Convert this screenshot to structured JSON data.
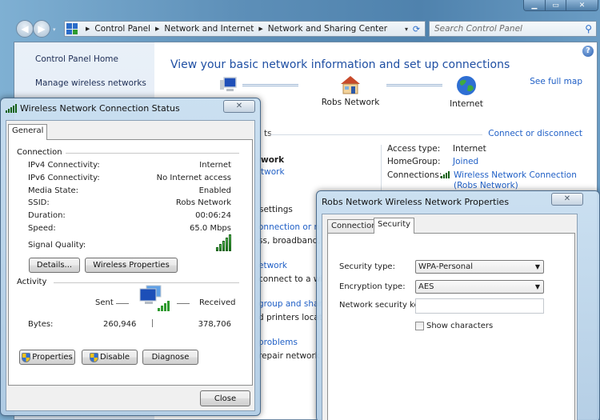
{
  "explorer": {
    "window_controls": {
      "minimize": "▁",
      "maximize": "▭",
      "close": "✕"
    },
    "nav": {
      "back_icon": "◀",
      "forward_icon": "▶",
      "dropdown_icon": "▾"
    },
    "breadcrumb": [
      "Control Panel",
      "Network and Internet",
      "Network and Sharing Center"
    ],
    "refresh_icon": "⟳",
    "search": {
      "placeholder": "Search Control Panel",
      "icon": "⚲"
    },
    "left_pane": {
      "items": [
        "Control Panel Home",
        "Manage wireless networks"
      ]
    },
    "help_icon": "?",
    "page_title": "View your basic network information and set up connections",
    "map": {
      "nodes": [
        "",
        "Robs Network",
        "Internet"
      ],
      "see_full_map": "See full map"
    },
    "connect_or_disconnect": "Connect or disconnect",
    "active_network_partial": {
      "section": "ts",
      "name": "work",
      "type": "twork"
    },
    "access": {
      "access_type_label": "Access type:",
      "access_type_value": "Internet",
      "homegroup_label": "HomeGroup:",
      "homegroup_value": "Joined",
      "connections_label": "Connections:",
      "connections_value_1": "Wireless Network Connection",
      "connections_value_2": "(Robs Network)"
    },
    "settings_partial": {
      "header": "settings",
      "items": [
        {
          "link": "onnection or n",
          "desc": "ss, broadband,"
        },
        {
          "link": "etwork",
          "desc": "connect to a wi"
        },
        {
          "link": "group and shar",
          "desc": "d printers locat"
        },
        {
          "link": "problems",
          "desc": "repair network"
        }
      ]
    }
  },
  "status_dialog": {
    "title": "Wireless Network Connection Status",
    "close_icon": "✕",
    "tabs": [
      "General"
    ],
    "connection_group": "Connection",
    "rows": [
      {
        "label": "IPv4 Connectivity:",
        "value": "Internet"
      },
      {
        "label": "IPv6 Connectivity:",
        "value": "No Internet access"
      },
      {
        "label": "Media State:",
        "value": "Enabled"
      },
      {
        "label": "SSID:",
        "value": "Robs Network"
      },
      {
        "label": "Duration:",
        "value": "00:06:24"
      },
      {
        "label": "Speed:",
        "value": "65.0 Mbps"
      }
    ],
    "signal_label": "Signal Quality:",
    "signal_bars": 5,
    "signal_max": 5,
    "details_button": "Details...",
    "wireless_props_button": "Wireless Properties",
    "activity_group": "Activity",
    "sent_label": "Sent",
    "received_label": "Received",
    "bytes_label": "Bytes:",
    "bytes_sent": "260,946",
    "bytes_received": "378,706",
    "properties_button": "Properties",
    "disable_button": "Disable",
    "diagnose_button": "Diagnose",
    "close_button": "Close"
  },
  "props_dialog": {
    "title": "Robs Network Wireless Network Properties",
    "close_icon": "✕",
    "tabs": [
      "Connection",
      "Security"
    ],
    "active_tab": "Security",
    "security_type_label": "Security type:",
    "security_type_value": "WPA-Personal",
    "encryption_type_label": "Encryption type:",
    "encryption_type_value": "AES",
    "key_label": "Network security key",
    "key_value": "",
    "show_characters_label": "Show characters",
    "show_characters_checked": false,
    "caret_icon": "▼"
  }
}
